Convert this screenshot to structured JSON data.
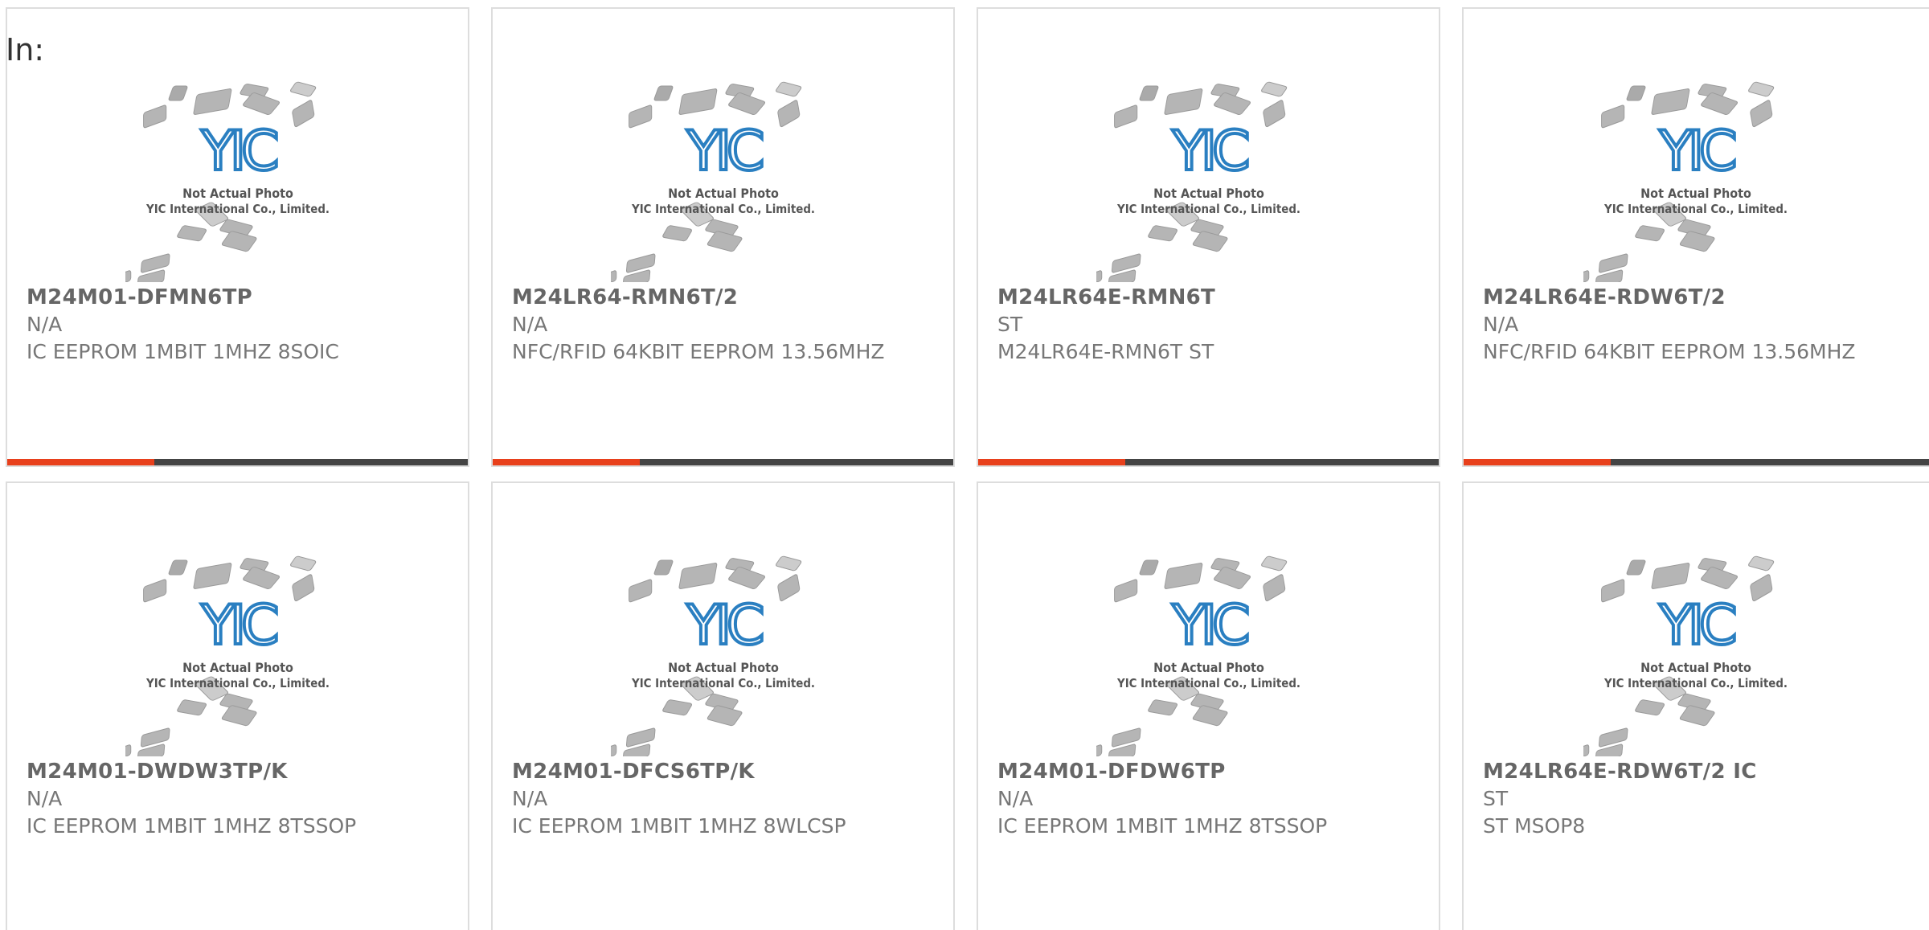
{
  "prefix": "In:",
  "placeholder_image": {
    "caption_line1": "Not Actual Photo",
    "caption_line2": "YIC International Co., Limited.",
    "logo_text": "YIC"
  },
  "colors": {
    "accent": "#e8401c",
    "bar": "#444444",
    "logo_blue": "#2a7fc1",
    "text": "#777777"
  },
  "products": [
    {
      "part": "M24M01-DFMN6TP",
      "manufacturer": "N/A",
      "description": "IC EEPROM 1MBIT 1MHZ 8SOIC"
    },
    {
      "part": "M24LR64-RMN6T/2",
      "manufacturer": "N/A",
      "description": "NFC/RFID 64KBIT EEPROM 13.56MHZ"
    },
    {
      "part": "M24LR64E-RMN6T",
      "manufacturer": "ST",
      "description": "M24LR64E-RMN6T ST"
    },
    {
      "part": "M24LR64E-RDW6T/2",
      "manufacturer": "N/A",
      "description": "NFC/RFID 64KBIT EEPROM 13.56MHZ"
    },
    {
      "part": "M24M01-DWDW3TP/K",
      "manufacturer": "N/A",
      "description": "IC EEPROM 1MBIT 1MHZ 8TSSOP"
    },
    {
      "part": "M24M01-DFCS6TP/K",
      "manufacturer": "N/A",
      "description": "IC EEPROM 1MBIT 1MHZ 8WLCSP"
    },
    {
      "part": "M24M01-DFDW6TP",
      "manufacturer": "N/A",
      "description": "IC EEPROM 1MBIT 1MHZ 8TSSOP"
    },
    {
      "part": "M24LR64E-RDW6T/2 IC",
      "manufacturer": "ST",
      "description": "ST MSOP8"
    }
  ]
}
